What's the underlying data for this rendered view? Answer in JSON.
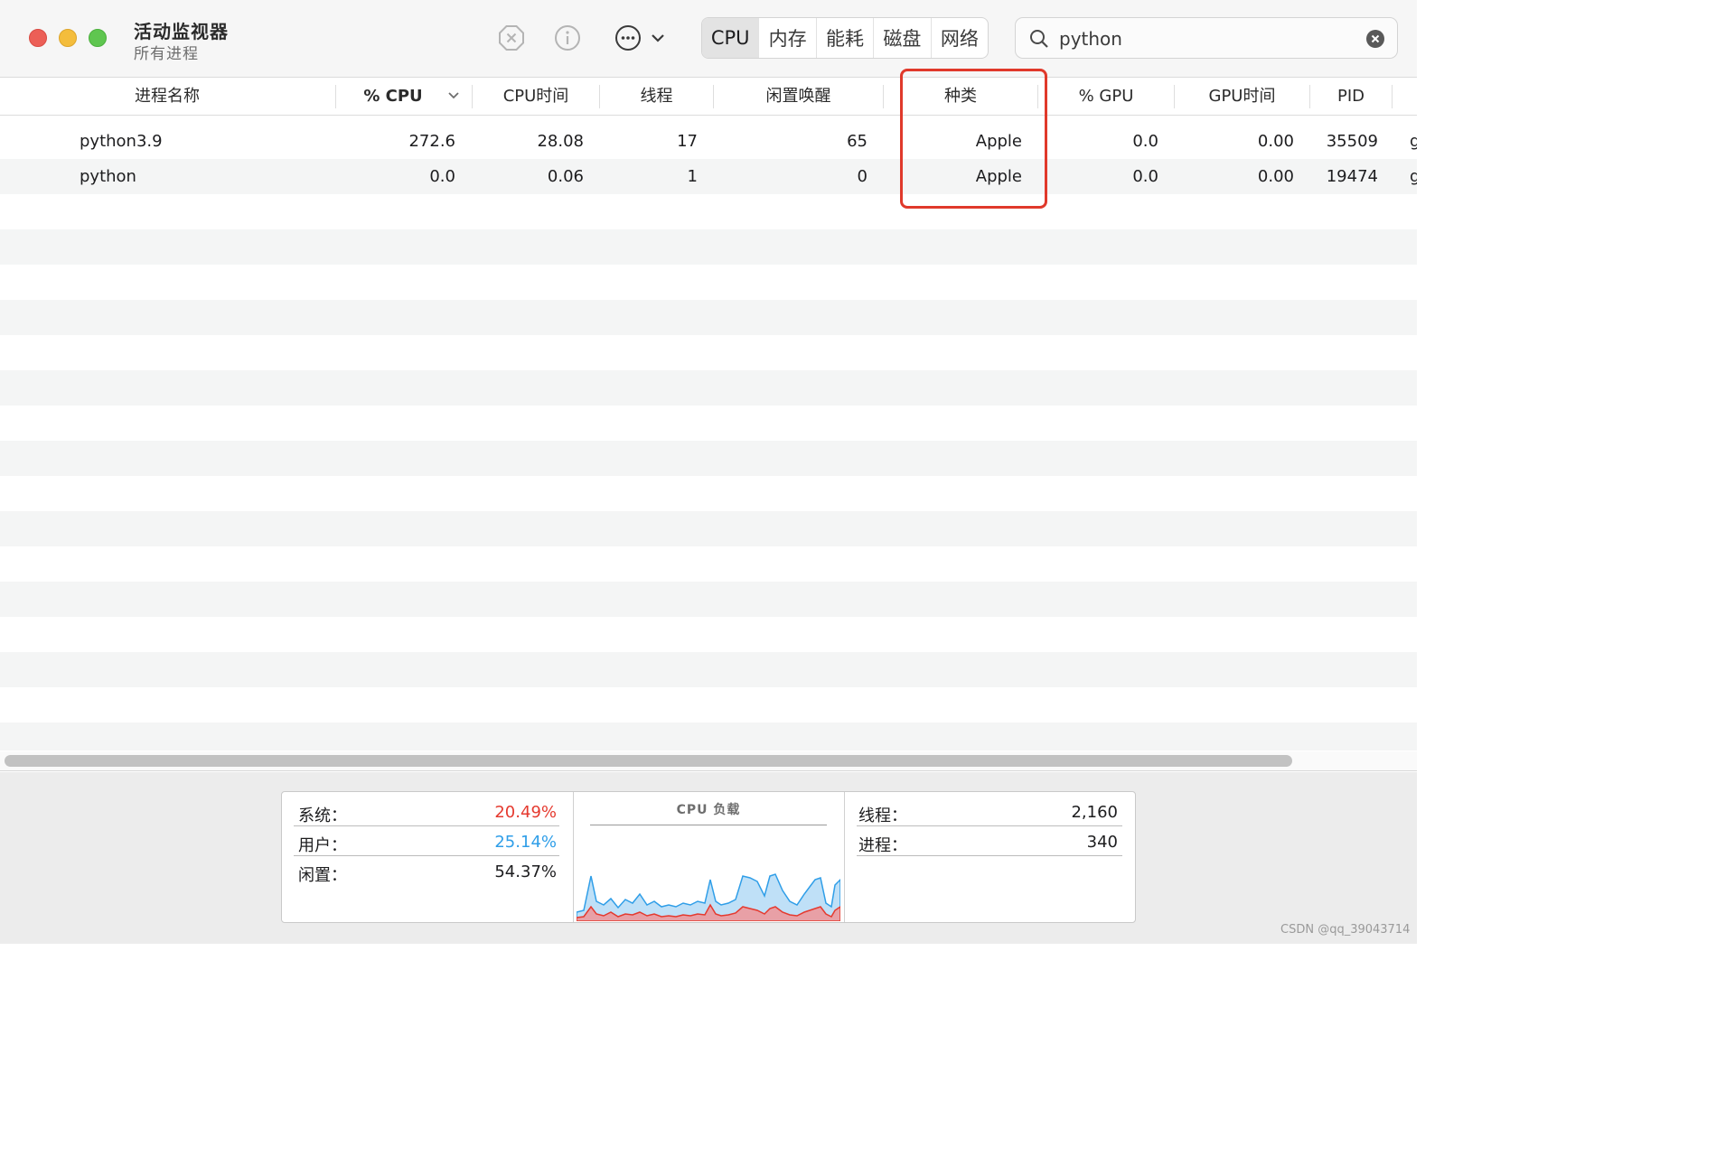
{
  "window": {
    "title": "活动监视器",
    "subtitle": "所有进程"
  },
  "toolbar": {
    "icons": [
      "stop-process-icon",
      "info-icon",
      "more-actions-icon",
      "chevron-down-icon"
    ],
    "tabs": [
      {
        "label": "CPU",
        "active": true
      },
      {
        "label": "内存",
        "active": false
      },
      {
        "label": "能耗",
        "active": false
      },
      {
        "label": "磁盘",
        "active": false
      },
      {
        "label": "网络",
        "active": false
      }
    ]
  },
  "search": {
    "value": "python",
    "icon": "search-icon",
    "clear_icon": "clear-search-icon"
  },
  "table": {
    "columns": [
      "进程名称",
      "% CPU",
      "CPU时间",
      "线程",
      "闲置唤醒",
      "种类",
      "% GPU",
      "GPU时间",
      "PID"
    ],
    "sorted_column": "% CPU",
    "rows": [
      {
        "name": "python3.9",
        "cpu": "272.6",
        "cpu_time": "28.08",
        "threads": "17",
        "idle_wake": "65",
        "kind": "Apple",
        "gpu": "0.0",
        "gpu_time": "0.00",
        "pid": "35509",
        "clipped": "g"
      },
      {
        "name": "python",
        "cpu": "0.0",
        "cpu_time": "0.06",
        "threads": "1",
        "idle_wake": "0",
        "kind": "Apple",
        "gpu": "0.0",
        "gpu_time": "0.00",
        "pid": "19474",
        "clipped": "g"
      }
    ],
    "highlighted_column": "种类"
  },
  "footer": {
    "system_label": "系统：",
    "system_value": "20.49%",
    "user_label": "用户：",
    "user_value": "25.14%",
    "idle_label": "闲置：",
    "idle_value": "54.37%",
    "graph_title": "CPU 负载",
    "threads_label": "线程：",
    "threads_value": "2,160",
    "processes_label": "进程：",
    "processes_value": "340"
  },
  "colors": {
    "system": "#e53a2f",
    "user": "#2f9ee8",
    "highlight_box": "#e0392b",
    "graph_user_fill": "#bfe0f7",
    "graph_system_fill": "#e8a0a6"
  },
  "watermark": "CSDN @qq_39043714"
}
